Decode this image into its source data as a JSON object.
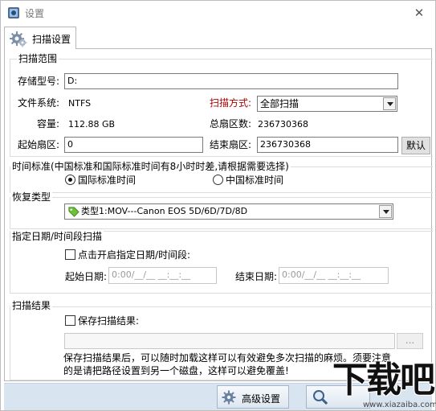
{
  "window": {
    "title": "设置",
    "close_glyph": "✕"
  },
  "tab": {
    "label": "扫描设置",
    "icon": "gear-icon"
  },
  "scan_range": {
    "title": "扫描范围",
    "storage_label": "存储型号:",
    "storage_value": "D:",
    "fs_label": "文件系统:",
    "fs_value": "NTFS",
    "method_label": "扫描方式:",
    "method_value": "全部扫描",
    "capacity_label": "容量:",
    "capacity_value": "112.88 GB",
    "total_sectors_label": "总扇区数:",
    "total_sectors_value": "236730368",
    "start_sector_label": "起始扇区:",
    "start_sector_value": "0",
    "end_sector_label": "结束扇区:",
    "end_sector_value": "236730368",
    "default_button": "默认"
  },
  "time_standard": {
    "title": "时间标准(中国标准和国际标准时间有8小时时差,请根据需要选择)",
    "international": "国际标准时间",
    "china": "中国标准时间",
    "selected": "international"
  },
  "recovery_type": {
    "title": "恢复类型",
    "value": "类型1:MOV---Canon EOS 5D/6D/7D/8D"
  },
  "date_range": {
    "title": "指定日期/时间段扫描",
    "enable_label": "点击开启指定日期/时间段:",
    "start_label": "起始日期:",
    "start_value": "0:00/__/__ __:__:__",
    "end_label": "结束日期:",
    "end_value": "0:00/__/__ __:__:__"
  },
  "scan_result": {
    "title": "扫描结果",
    "save_label": "保存扫描结果:",
    "path_value": "",
    "browse_button": "...",
    "note_line1": "保存扫描结果后，可以随时加载这样可以有效避免多次扫描的麻烦。须要注意",
    "note_line2": "的是请把路径设置到另一个磁盘，这样可以避免覆盖!"
  },
  "bottom": {
    "advanced_button": "高级设置"
  },
  "watermark": {
    "big": "下载吧",
    "small": "www.xiazaiba.com"
  },
  "colors": {
    "accent_red": "#b00000",
    "bottom_bar": "#d9e4f1"
  }
}
